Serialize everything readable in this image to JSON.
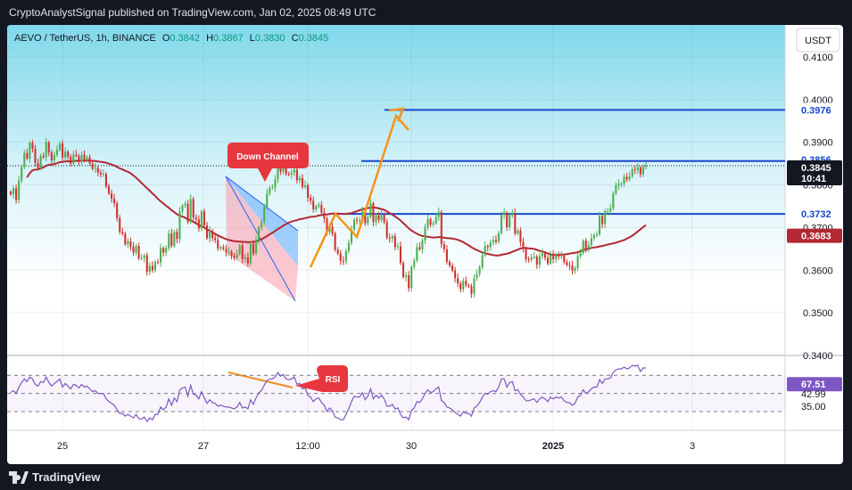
{
  "header": {
    "published_text": "CryptoAnalystSignal published on TradingView.com, Jan 02, 2025 08:49 UTC"
  },
  "footer": {
    "brand": "TradingView"
  },
  "legend": {
    "symbol": "AEVO / TetherUS, 1h, BINANCE",
    "o_label": "O",
    "o_value": "0.3842",
    "h_label": "H",
    "h_value": "0.3867",
    "l_label": "L",
    "l_value": "0.3830",
    "c_label": "C",
    "c_value": "0.3845"
  },
  "currency_button": "USDT",
  "colors": {
    "up": "#4caf50",
    "down": "#d32f2f",
    "ma": "#b22833",
    "level": "#1848cc",
    "arrow": "#f7931a",
    "rsi": "#7e57c2",
    "bg_top": "#7fd8ea"
  },
  "chart_data": {
    "type": "candlestick",
    "price_axis": {
      "ticks": [
        "0.4100",
        "0.4000",
        "0.3900",
        "0.3800",
        "0.3700",
        "0.3600",
        "0.3500",
        "0.3400"
      ],
      "range": [
        0.3395,
        0.413
      ]
    },
    "time_axis": {
      "ticks": [
        "25",
        "27",
        "12:00",
        "30",
        "2025",
        "3"
      ]
    },
    "levels": [
      {
        "value": 0.3976,
        "label": "0.3976"
      },
      {
        "value": 0.3856,
        "label": "0.3856"
      },
      {
        "value": 0.3732,
        "label": "0.3732"
      }
    ],
    "current_price": {
      "value": 0.3845,
      "label": "0.3845",
      "countdown": "10:41"
    },
    "ma": {
      "value": 0.3683,
      "label": "0.3683"
    },
    "annotations": {
      "down_channel": "Down Channel",
      "rsi": "RSI"
    },
    "rsi": {
      "value_label": "67.51",
      "levels": [
        "42.99",
        "35.00"
      ]
    },
    "closes": [
      0.3778,
      0.3792,
      0.3765,
      0.381,
      0.3842,
      0.3875,
      0.3862,
      0.3899,
      0.3885,
      0.3851,
      0.384,
      0.3868,
      0.3865,
      0.39,
      0.3876,
      0.3858,
      0.387,
      0.3882,
      0.3897,
      0.3864,
      0.3878,
      0.3866,
      0.385,
      0.3871,
      0.3868,
      0.3856,
      0.3871,
      0.386,
      0.3865,
      0.385,
      0.3838,
      0.384,
      0.3829,
      0.3825,
      0.3826,
      0.3797,
      0.378,
      0.3768,
      0.3757,
      0.3722,
      0.369,
      0.3686,
      0.3661,
      0.3668,
      0.3655,
      0.3641,
      0.3657,
      0.3628,
      0.3628,
      0.3635,
      0.3596,
      0.361,
      0.36,
      0.3619,
      0.3618,
      0.3652,
      0.3641,
      0.3652,
      0.3686,
      0.3657,
      0.369,
      0.3673,
      0.3738,
      0.3752,
      0.3756,
      0.3713,
      0.3767,
      0.3724,
      0.3719,
      0.3698,
      0.3738,
      0.3705,
      0.3675,
      0.3692,
      0.3676,
      0.3671,
      0.3651,
      0.3654,
      0.365,
      0.3642,
      0.3643,
      0.3633,
      0.3629,
      0.3638,
      0.3658,
      0.3626,
      0.363,
      0.3616,
      0.3662,
      0.3639,
      0.3671,
      0.3701,
      0.3713,
      0.3748,
      0.378,
      0.3793,
      0.3794,
      0.3813,
      0.3845,
      0.3831,
      0.3844,
      0.3826,
      0.3824,
      0.3829,
      0.3836,
      0.3811,
      0.3816,
      0.3795,
      0.3799,
      0.377,
      0.3763,
      0.3743,
      0.375,
      0.3753,
      0.3735,
      0.3721,
      0.369,
      0.3702,
      0.3686,
      0.3648,
      0.3639,
      0.3622,
      0.3621,
      0.3645,
      0.3664,
      0.3695,
      0.3719,
      0.3717,
      0.3717,
      0.3738,
      0.371,
      0.3725,
      0.3757,
      0.3713,
      0.3728,
      0.3718,
      0.373,
      0.3713,
      0.3676,
      0.3674,
      0.368,
      0.3654,
      0.3656,
      0.3617,
      0.3584,
      0.3588,
      0.3558,
      0.3608,
      0.3623,
      0.3654,
      0.3649,
      0.367,
      0.3701,
      0.372,
      0.3707,
      0.371,
      0.3725,
      0.3736,
      0.3661,
      0.3649,
      0.362,
      0.3611,
      0.3599,
      0.3581,
      0.3569,
      0.3555,
      0.3575,
      0.3565,
      0.3562,
      0.3545,
      0.3582,
      0.3591,
      0.3607,
      0.3635,
      0.3657,
      0.3654,
      0.3665,
      0.3671,
      0.3667,
      0.3687,
      0.373,
      0.3735,
      0.3701,
      0.3729,
      0.3734,
      0.3686,
      0.3693,
      0.3666,
      0.3651,
      0.3626,
      0.3624,
      0.363,
      0.3632,
      0.3613,
      0.3633,
      0.364,
      0.3629,
      0.3616,
      0.3636,
      0.3626,
      0.3636,
      0.3632,
      0.3634,
      0.3619,
      0.3612,
      0.3611,
      0.3599,
      0.3605,
      0.3633,
      0.364,
      0.3669,
      0.3651,
      0.3659,
      0.3675,
      0.3682,
      0.3684,
      0.3727,
      0.3708,
      0.3738,
      0.3738,
      0.3745,
      0.378,
      0.3799,
      0.3803,
      0.3803,
      0.3819,
      0.3813,
      0.382,
      0.3837,
      0.3835,
      0.3841,
      0.3825,
      0.3842,
      0.3845
    ],
    "rsi_values": [
      51,
      53,
      50,
      57,
      62,
      66,
      63,
      68,
      66,
      60,
      58,
      63,
      62,
      68,
      62,
      58,
      61,
      63,
      66,
      57,
      61,
      58,
      55,
      60,
      59,
      56,
      60,
      57,
      58,
      55,
      52,
      53,
      50,
      50,
      50,
      44,
      41,
      39,
      37,
      32,
      28,
      28,
      25,
      27,
      25,
      23,
      27,
      22,
      22,
      24,
      19,
      23,
      21,
      27,
      27,
      35,
      32,
      35,
      44,
      37,
      45,
      41,
      54,
      56,
      57,
      47,
      59,
      49,
      48,
      44,
      52,
      45,
      39,
      43,
      40,
      39,
      36,
      37,
      36,
      35,
      35,
      34,
      33,
      35,
      40,
      34,
      35,
      33,
      43,
      38,
      45,
      51,
      53,
      59,
      64,
      66,
      66,
      68,
      73,
      69,
      71,
      66,
      65,
      66,
      68,
      60,
      61,
      55,
      56,
      48,
      46,
      41,
      44,
      45,
      40,
      37,
      30,
      34,
      31,
      24,
      23,
      21,
      21,
      27,
      33,
      41,
      47,
      46,
      46,
      51,
      43,
      47,
      55,
      44,
      48,
      45,
      48,
      44,
      36,
      36,
      38,
      33,
      34,
      27,
      23,
      24,
      21,
      31,
      34,
      41,
      40,
      44,
      50,
      54,
      51,
      52,
      55,
      57,
      42,
      40,
      35,
      34,
      32,
      29,
      27,
      25,
      30,
      28,
      28,
      25,
      34,
      36,
      40,
      46,
      50,
      49,
      52,
      53,
      52,
      57,
      66,
      66,
      57,
      62,
      63,
      53,
      54,
      49,
      46,
      42,
      42,
      43,
      44,
      40,
      44,
      46,
      44,
      41,
      46,
      44,
      46,
      45,
      46,
      42,
      40,
      40,
      37,
      39,
      46,
      48,
      54,
      50,
      52,
      55,
      57,
      57,
      65,
      61,
      66,
      66,
      67,
      73,
      76,
      77,
      77,
      79,
      77,
      78,
      81,
      80,
      81,
      74,
      78,
      78
    ]
  }
}
